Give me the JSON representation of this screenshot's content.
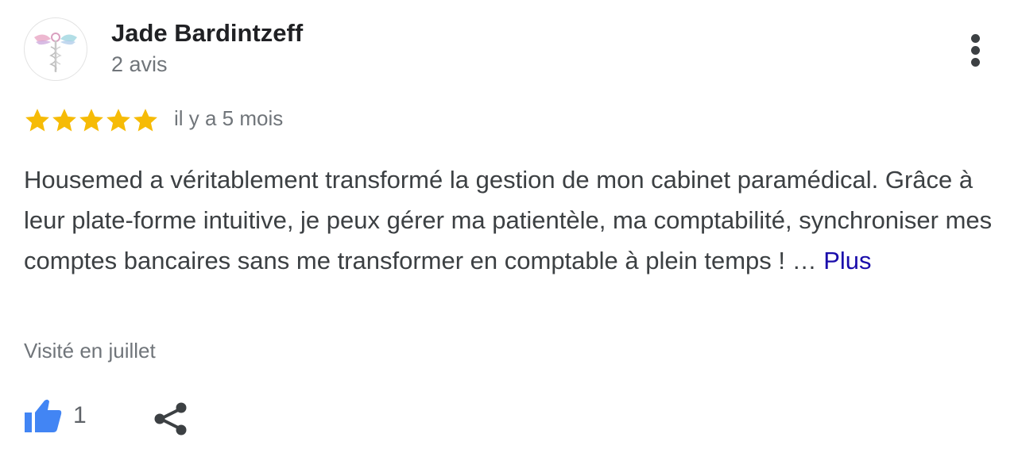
{
  "reviewer": {
    "name": "Jade Bardintzeff",
    "review_count_label": "2 avis",
    "avatar_icon": "caduceus-logo-icon"
  },
  "review": {
    "rating": 5,
    "rating_max": 5,
    "star_color": "#f6bb06",
    "date": "il y a 5 mois",
    "text": "Housemed a véritablement transformé la gestion de mon cabinet paramédical. Grâce à leur plate-forme intuitive, je peux gérer ma patientèle, ma comptabilité, synchroniser mes comptes bancaires sans me transformer en comptable à plein temps ! … ",
    "more_label": "Plus",
    "visited": "Visité en juillet"
  },
  "actions": {
    "like_icon": "thumbs-up-icon",
    "like_color": "#4285f4",
    "like_count": "1",
    "share_icon": "share-icon",
    "menu_icon": "more-vertical-icon"
  }
}
